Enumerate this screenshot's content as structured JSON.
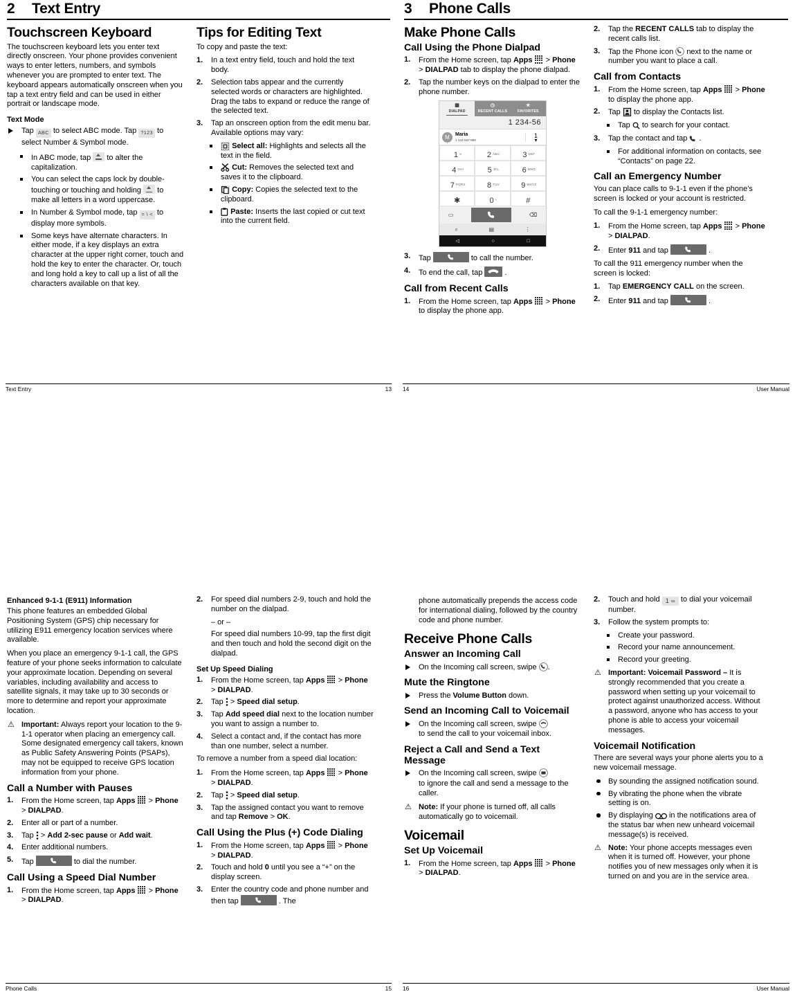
{
  "pages": {
    "p13": {
      "chapter_num": "2",
      "chapter_title": "Text Entry",
      "footer_left": "Text Entry",
      "footer_right": "13",
      "col1": {
        "h1": "Touchscreen Keyboard",
        "intro": "The touchscreen keyboard lets you enter text directly onscreen. Your phone provides convenient ways to enter letters, numbers, and symbols whenever you are prompted to enter text. The keyboard appears automatically onscreen when you tap a text entry field and can be used in either portrait or landscape mode.",
        "h3": "Text Mode",
        "arrow_1a": "Tap",
        "key_abc": "ABC",
        "arrow_1b": "to select ABC mode. Tap",
        "key_123": "?123",
        "arrow_1c": "to select Number & Symbol mode.",
        "sq1a": "In ABC mode, tap",
        "sq1b": "to alter the capitalization.",
        "sq2a": "You can select the caps lock by double-touching or touching and holding",
        "sq2b": "to make all letters in a word uppercase.",
        "sq3a": "In Number & Symbol mode, tap",
        "key_sym": "= \\ <",
        "sq3b": "to display more symbols.",
        "sq4": "Some keys have alternate characters. In either mode, if a key displays an extra character at the upper right corner, touch and hold the key to enter the character. Or, touch and long hold a key to call up a list of all the characters available on that key."
      },
      "col2": {
        "h1": "Tips for Editing Text",
        "intro": "To copy and paste the text:",
        "steps": [
          "In a text entry field, touch and hold the text body.",
          "Selection tabs appear and the currently selected words or characters are highlighted. Drag the tabs to expand or reduce the range of the selected text.",
          "Tap an onscreen option from the edit menu bar. Available options may vary:"
        ],
        "options": [
          {
            "icon": "select-all-icon",
            "label": "Select all:",
            "text": "Highlights and selects all the text in the field."
          },
          {
            "icon": "scissors-cut-icon",
            "label": "Cut:",
            "text": "Removes the selected text and saves it to the clipboard."
          },
          {
            "icon": "copy-icon",
            "label": "Copy:",
            "text": "Copies the selected text to the clipboard."
          },
          {
            "icon": "paste-clipboard-icon",
            "label": "Paste:",
            "text": "Inserts the last copied or cut text into the current field."
          }
        ]
      }
    },
    "p14": {
      "chapter_num": "3",
      "chapter_title": "Phone Calls",
      "footer_left": "14",
      "footer_right": "User Manual",
      "col1": {
        "h1": "Make Phone Calls",
        "h2": "Call Using the Phone Dialpad",
        "step1a": "From the Home screen, tap",
        "step1_apps": "Apps",
        "step1b": ">",
        "step1_phone": "Phone",
        "step1_gt": ">",
        "step1_dialpad": "DIALPAD",
        "step1c": "tab to display the phone dialpad.",
        "step2": "Tap the number keys on the dialpad to enter the phone number.",
        "figure": {
          "tabs": [
            {
              "label": "DIALPAD",
              "icon": "grid-icon",
              "active": true
            },
            {
              "label": "RECENT CALLS",
              "icon": "clock-icon",
              "active": false
            },
            {
              "label": "FAVORITES",
              "icon": "star-icon",
              "active": false
            }
          ],
          "entered_number": "1 234-56",
          "contact_initial": "M",
          "contact_name": "Maria",
          "contact_number": "1 234-567-890",
          "contact_count": "1",
          "keys": [
            {
              "digit": "1",
              "letters": "∞"
            },
            {
              "digit": "2",
              "letters": "ABC"
            },
            {
              "digit": "3",
              "letters": "DEF"
            },
            {
              "digit": "4",
              "letters": "GHI"
            },
            {
              "digit": "5",
              "letters": "JKL"
            },
            {
              "digit": "6",
              "letters": "MNO"
            },
            {
              "digit": "7",
              "letters": "PQRS"
            },
            {
              "digit": "8",
              "letters": "TUV"
            },
            {
              "digit": "9",
              "letters": "WXYZ"
            },
            {
              "digit": "✱",
              "letters": ""
            },
            {
              "digit": "0",
              "letters": "+"
            },
            {
              "digit": "#",
              "letters": ""
            }
          ],
          "action_left_icon": "message-icon",
          "action_call_icon": "phone-handset-icon",
          "action_right_icon": "backspace-icon",
          "bottom_icons": [
            "search-icon",
            "contacts-icon",
            "overflow-menu-icon"
          ],
          "nav_icons": [
            "back-nav-icon",
            "home-nav-icon",
            "recents-nav-icon"
          ]
        },
        "step3a": "Tap",
        "step3b": "to call the number.",
        "step4a": "To end the call, tap",
        "step4b": ".",
        "h2b": "Call from Recent Calls",
        "recent_step1a": "From the Home screen, tap",
        "recent_step1b": "to display the phone app."
      },
      "col2": {
        "step2a": "Tap the",
        "step2_bold": "RECENT CALLS",
        "step2b": "tab to display the recent calls list.",
        "step3a": "Tap the Phone icon",
        "step3b": "next to the name or number you want to place a call.",
        "h2": "Call from Contacts",
        "c_step1a": "From the Home screen, tap",
        "c_step1b": "to display the phone app.",
        "c_step2a": "Tap",
        "c_step2b": "to display the Contacts list.",
        "c_step2_sq_a": "Tap",
        "c_step2_sq_b": "to search for your contact.",
        "c_step3a": "Tap the contact and tap",
        "c_step3b": ".",
        "c_step3_sq": "For additional information on contacts, see “Contacts” on page 22.",
        "h2b": "Call an Emergency Number",
        "emerg_intro": "You can place calls to 9-1-1 even if the phone’s screen is locked or your account is restricted.",
        "emerg_to": "To call the 9-1-1 emergency number:",
        "e_step1a": "From the Home screen, tap",
        "e_step2a": "Enter",
        "e_step2_bold": "911",
        "e_step2b": "and tap",
        "e_step2c": ".",
        "locked_intro": "To call the 911 emergency number when the screen is locked:",
        "l_step1a": "Tap",
        "l_step1_bold": "EMERGENCY CALL",
        "l_step1b": "on the screen.",
        "l_step2a": "Enter",
        "l_step2_bold": "911",
        "l_step2b": "and tap",
        "l_step2c": "."
      }
    },
    "p15": {
      "footer_left": "Phone Calls",
      "footer_right": "15",
      "col1": {
        "h3": "Enhanced 9-1-1 (E911) Information",
        "p1": "This phone features an embedded Global Positioning System (GPS) chip necessary for utilizing E911 emergency location services where available.",
        "p2": "When you place an emergency 9-1-1 call, the GPS feature of your phone seeks information to calculate your approximate location. Depending on several variables, including availability and access to satellite signals, it may take up to 30 seconds or more to determine and report your approximate location.",
        "note_label": "Important:",
        "note_text": "Always report your location to the 9-1-1 operator when placing an emergency call. Some designated emergency call takers, known as Public Safety Answering Points (PSAPs), may not be equipped to receive GPS location information from your phone.",
        "h2": "Call a Number with Pauses",
        "steps": {
          "s1a": "From the Home screen, tap",
          "s2": "Enter all or part of a number.",
          "s3a": "Tap",
          "s3b": ">",
          "s3_bold1": "Add 2-sec pause",
          "s3_or": "or",
          "s3_bold2": "Add wait",
          "s3c": ".",
          "s4": "Enter additional numbers.",
          "s5a": "Tap",
          "s5b": "to dial the number."
        },
        "h2b": "Call Using a Speed Dial Number",
        "sd_step1a": "From the Home screen, tap"
      },
      "col2": {
        "step2": "For speed dial numbers 2-9, touch and hold the number on the dialpad.",
        "or": "– or –",
        "step2b": "For speed dial numbers 10-99, tap the first digit and then touch and hold the second digit on the dialpad.",
        "h3": "Set Up Speed Dialing",
        "su_step1a": "From the Home screen, tap",
        "su_step2a": "Tap",
        "su_step2b": ">",
        "su_step2_bold": "Speed dial setup",
        "su_step2c": ".",
        "su_step3a": "Tap",
        "su_step3_bold": "Add speed dial",
        "su_step3b": "next to the location number you want to assign a number to.",
        "su_step4": "Select a contact and, if the contact has more than one number, select a number.",
        "remove_intro": "To remove a number from a speed dial location:",
        "r_step1a": "From the Home screen, tap",
        "r_step2a": "Tap",
        "r_step2b": ">",
        "r_step2_bold": "Speed dial setup",
        "r_step2c": ".",
        "r_step3a": "Tap the assigned contact you want to remove and tap",
        "r_step3_bold1": "Remove",
        "r_step3_gt": ">",
        "r_step3_bold2": "OK",
        "r_step3b": ".",
        "h2": "Call Using the Plus (+) Code Dialing",
        "pc_step1a": "From the Home screen, tap",
        "pc_step2a": "Touch and hold",
        "pc_step2_bold": "0",
        "pc_step2b": "until you see a “+” on the display screen.",
        "pc_step3a": "Enter the country code and phone number and then tap",
        "pc_step3b": ". The"
      }
    },
    "p16": {
      "footer_left": "16",
      "footer_right": "User Manual",
      "col1": {
        "cont": "phone automatically prepends the access code for international dialing, followed by the country code and phone number.",
        "h1": "Receive Phone Calls",
        "h2": "Answer an Incoming Call",
        "a_arrow_a": "On the Incoming call screen, swipe",
        "a_arrow_b": ".",
        "h2b": "Mute the Ringtone",
        "m_arrow_a": "Press the",
        "m_arrow_bold": "Volume Button",
        "m_arrow_b": "down.",
        "h2c": "Send an Incoming Call to Voicemail",
        "s_arrow_a": "On the Incoming call screen, swipe",
        "s_arrow_b": "to send the call to your voicemail inbox.",
        "h2d": "Reject a Call and Send a Text Message",
        "r_arrow_a": "On the Incoming call screen, swipe",
        "r_arrow_b": "to ignore the call and send a message to the caller.",
        "note_label": "Note:",
        "note_text": "If your phone is turned off, all calls automatically go to voicemail.",
        "h1b": "Voicemail",
        "h2e": "Set Up Voicemail",
        "v_step1a": "From the Home screen, tap"
      },
      "col2": {
        "step2a": "Touch and hold",
        "step2_key": "1",
        "step2b": "to dial your voicemail number.",
        "step3": "Follow the system prompts to:",
        "sq_items": [
          "Create your password.",
          "Record your name announcement.",
          "Record your greeting."
        ],
        "note_label": "Important: Voicemail Password –",
        "note_text": "It is strongly recommended that you create a password when setting up your voicemail to protect against unauthorized access. Without a password, anyone who has access to your phone is able to access your voicemail messages.",
        "h2": "Voicemail Notification",
        "vn_intro": "There are several ways your phone alerts you to a new voicemail message.",
        "dots": [
          "By sounding the assigned notification sound.",
          "By vibrating the phone when the vibrate setting is on.",
          "By displaying"
        ],
        "dot3b": "in the notifications area of the status bar when new unheard voicemail message(s) is received.",
        "note2_label": "Note:",
        "note2_text": "Your phone accepts messages even when it is turned off. However, your phone notifies you of new messages only when it is turned on and you are in the service area."
      }
    }
  },
  "shared": {
    "apps_label": "Apps",
    "phone_label": "Phone",
    "dialpad_label": "DIALPAD",
    "gt": ">",
    "warn_glyph": "⚠"
  }
}
